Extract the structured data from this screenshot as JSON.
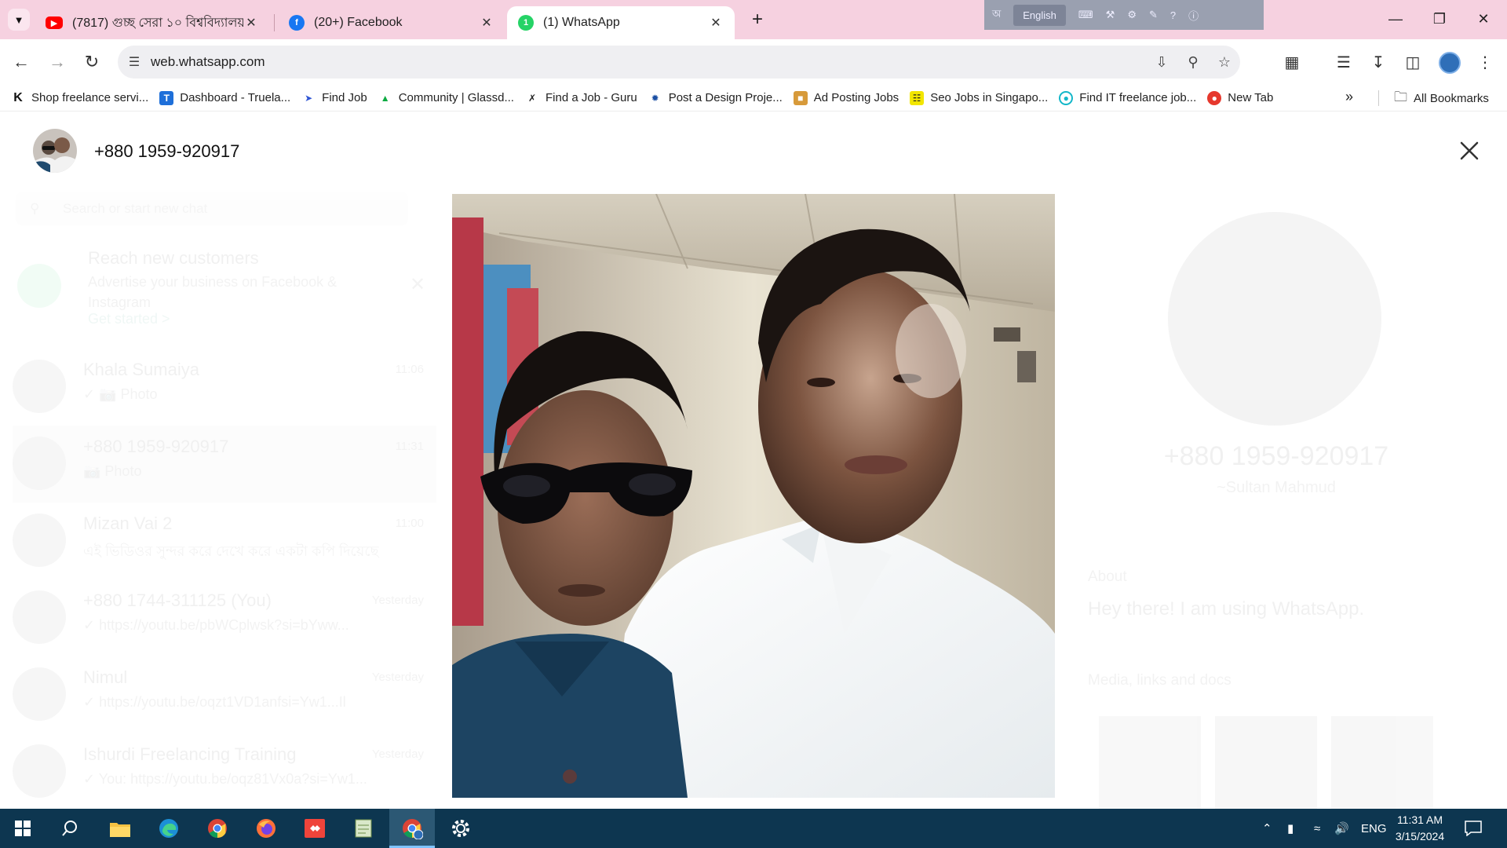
{
  "browser": {
    "tabs": [
      {
        "title": "(7817) গুচ্ছ সেরা ১০ বিশ্ববিদ্যালয়",
        "favicon": "youtube-icon",
        "active": false
      },
      {
        "title": "(20+) Facebook",
        "favicon": "facebook-icon",
        "active": false
      },
      {
        "title": "(1) WhatsApp",
        "favicon": "whatsapp-icon",
        "active": true
      }
    ],
    "ime_language": "English",
    "url": "web.whatsapp.com",
    "tab_strip_color": "#f6d1e0"
  },
  "bookmarks": {
    "items": [
      {
        "label": "Shop freelance servi...",
        "icon": "k-icon"
      },
      {
        "label": "Dashboard - Truela...",
        "icon": "truelancer-icon"
      },
      {
        "label": "Find Job",
        "icon": "send-icon"
      },
      {
        "label": "Community | Glassd...",
        "icon": "glassdoor-icon"
      },
      {
        "label": "Find a Job - Guru",
        "icon": "guru-icon"
      },
      {
        "label": "Post a Design Proje...",
        "icon": "design-icon"
      },
      {
        "label": "Ad Posting Jobs",
        "icon": "folder-icon"
      },
      {
        "label": "Seo Jobs in Singapo...",
        "icon": "seo-icon"
      },
      {
        "label": "Find IT freelance job...",
        "icon": "freelance-icon"
      },
      {
        "label": "New Tab",
        "icon": "newtab-icon"
      }
    ],
    "all_label": "All Bookmarks"
  },
  "viewer": {
    "contact": "+880 1959-920917"
  },
  "whatsapp": {
    "search_placeholder": "Search or start new chat",
    "promo": {
      "title": "Reach new customers",
      "text": "Advertise your business on Facebook & Instagram",
      "cta": "Get started >"
    },
    "chats": [
      {
        "name": "Khala Sumaiya",
        "time": "11:06",
        "preview": "✓ 📷 Photo"
      },
      {
        "name": "+880 1959-920917",
        "time": "11:31",
        "preview": "📷 Photo"
      },
      {
        "name": "Mizan Vai 2",
        "time": "11:00",
        "preview": "এই ভিডিওর সুন্দর করে দেখে করে একটা কপি দিয়েছে"
      },
      {
        "name": "+880 1744-311125 (You)",
        "time": "Yesterday",
        "preview": "✓ https://youtu.be/pbWCplwsk?si=bYww..."
      },
      {
        "name": "Nimul",
        "time": "Yesterday",
        "preview": "✓ https://youtu.be/oqzt1VD1anfsi=Yw1...Il"
      },
      {
        "name": "Ishurdi Freelancing Training",
        "time": "Yesterday",
        "preview": "✓ You: https://youtu.be/oqz81Vx0a?si=Yw1..."
      }
    ],
    "info": {
      "name": "+880 1959-920917",
      "subtitle": "~Sultan Mahmud",
      "about_label": "About",
      "about_text": "Hey there! I am using WhatsApp.",
      "media_label": "Media, links and docs"
    }
  },
  "taskbar": {
    "apps": [
      "windows-start-icon",
      "search-icon",
      "file-explorer-icon",
      "edge-icon",
      "chrome-icon",
      "firefox-icon",
      "anydesk-icon",
      "notepad-icon",
      "chrome-profile-icon",
      "settings-icon"
    ],
    "language": "ENG",
    "time": "11:31 AM",
    "date": "3/15/2024"
  }
}
